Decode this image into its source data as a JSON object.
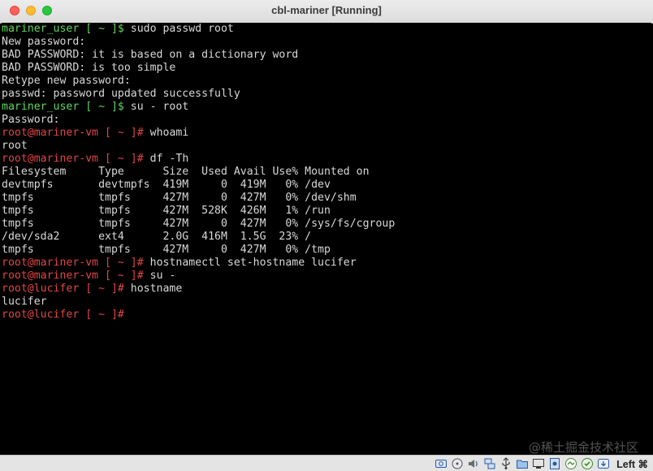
{
  "window": {
    "title": "cbl-mariner [Running]"
  },
  "terminal": {
    "lines": [
      [
        {
          "t": "mariner_user [ ~ ]$ ",
          "c": "green"
        },
        {
          "t": "sudo passwd root",
          "c": "plain"
        }
      ],
      [
        {
          "t": "New password:",
          "c": "plain"
        }
      ],
      [
        {
          "t": "BAD PASSWORD: it is based on a dictionary word",
          "c": "plain"
        }
      ],
      [
        {
          "t": "BAD PASSWORD: is too simple",
          "c": "plain"
        }
      ],
      [
        {
          "t": "Retype new password:",
          "c": "plain"
        }
      ],
      [
        {
          "t": "passwd: password updated successfully",
          "c": "plain"
        }
      ],
      [
        {
          "t": "mariner_user [ ~ ]$ ",
          "c": "green"
        },
        {
          "t": "su - root",
          "c": "plain"
        }
      ],
      [
        {
          "t": "Password:",
          "c": "plain"
        }
      ],
      [
        {
          "t": "root@mariner-vm [ ~ ]# ",
          "c": "red"
        },
        {
          "t": "whoami",
          "c": "plain"
        }
      ],
      [
        {
          "t": "root",
          "c": "plain"
        }
      ],
      [
        {
          "t": "root@mariner-vm [ ~ ]# ",
          "c": "red"
        },
        {
          "t": "df -Th",
          "c": "plain"
        }
      ],
      [
        {
          "t": "Filesystem     Type      Size  Used Avail Use% Mounted on",
          "c": "plain"
        }
      ],
      [
        {
          "t": "devtmpfs       devtmpfs  419M     0  419M   0% /dev",
          "c": "plain"
        }
      ],
      [
        {
          "t": "tmpfs          tmpfs     427M     0  427M   0% /dev/shm",
          "c": "plain"
        }
      ],
      [
        {
          "t": "tmpfs          tmpfs     427M  528K  426M   1% /run",
          "c": "plain"
        }
      ],
      [
        {
          "t": "tmpfs          tmpfs     427M     0  427M   0% /sys/fs/cgroup",
          "c": "plain"
        }
      ],
      [
        {
          "t": "/dev/sda2      ext4      2.0G  416M  1.5G  23% /",
          "c": "plain"
        }
      ],
      [
        {
          "t": "tmpfs          tmpfs     427M     0  427M   0% /tmp",
          "c": "plain"
        }
      ],
      [
        {
          "t": "root@mariner-vm [ ~ ]# ",
          "c": "red"
        },
        {
          "t": "hostnamectl set-hostname lucifer",
          "c": "plain"
        }
      ],
      [
        {
          "t": "root@mariner-vm [ ~ ]# ",
          "c": "red"
        },
        {
          "t": "su -",
          "c": "plain"
        }
      ],
      [
        {
          "t": "root@lucifer [ ~ ]# ",
          "c": "red"
        },
        {
          "t": "hostname",
          "c": "plain"
        }
      ],
      [
        {
          "t": "lucifer",
          "c": "plain"
        }
      ],
      [
        {
          "t": "root@lucifer [ ~ ]#",
          "c": "red"
        },
        {
          "t": "",
          "c": "cursor"
        }
      ]
    ]
  },
  "watermark": "@稀土掘金技术社区",
  "statusbar": {
    "icons": [
      "hard-disk-icon",
      "optical-drive-icon",
      "audio-icon",
      "network-icon",
      "usb-icon",
      "shared-folders-icon",
      "display-icon",
      "video-capture-icon",
      "recording-icon",
      "mouse-integration-icon",
      "keyboard-capture-icon"
    ],
    "host_key": "Left ⌘"
  }
}
